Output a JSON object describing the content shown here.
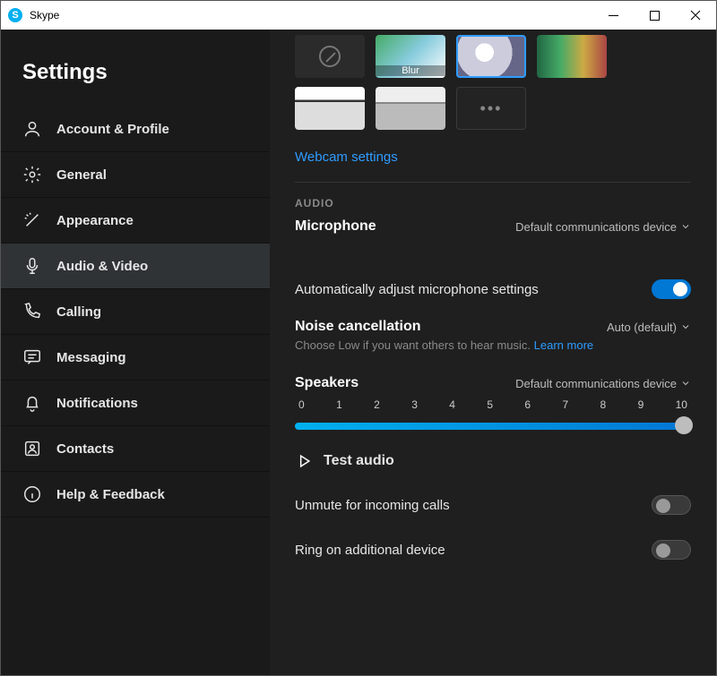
{
  "window": {
    "title": "Skype"
  },
  "sidebar": {
    "title": "Settings",
    "items": [
      {
        "label": "Account & Profile"
      },
      {
        "label": "General"
      },
      {
        "label": "Appearance"
      },
      {
        "label": "Audio & Video"
      },
      {
        "label": "Calling"
      },
      {
        "label": "Messaging"
      },
      {
        "label": "Notifications"
      },
      {
        "label": "Contacts"
      },
      {
        "label": "Help & Feedback"
      }
    ]
  },
  "backgrounds": {
    "blur_label": "Blur",
    "more": "•••",
    "webcam_link": "Webcam settings"
  },
  "audio": {
    "section_label": "AUDIO",
    "mic_label": "Microphone",
    "mic_device": "Default communications device",
    "auto_adjust_label": "Automatically adjust microphone settings",
    "noise_label": "Noise cancellation",
    "noise_value": "Auto (default)",
    "noise_sub": "Choose Low if you want others to hear music.",
    "learn_more": "Learn more",
    "speakers_label": "Speakers",
    "speakers_device": "Default communications device",
    "ticks": [
      "0",
      "1",
      "2",
      "3",
      "4",
      "5",
      "6",
      "7",
      "8",
      "9",
      "10"
    ],
    "slider_value_pct": 100,
    "test_label": "Test audio",
    "unmute_label": "Unmute for incoming calls",
    "ring_label": "Ring on additional device"
  }
}
